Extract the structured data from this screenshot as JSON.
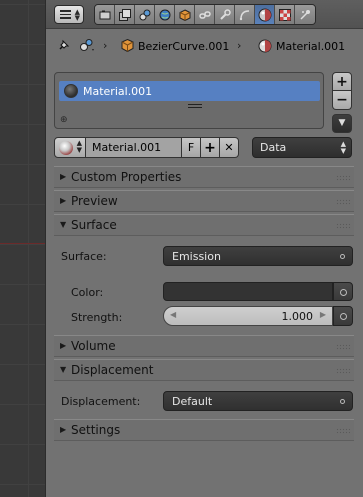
{
  "header": {
    "editor_type_icon": "properties-editor-icon",
    "context_tabs": [
      {
        "name": "render-icon",
        "active": false
      },
      {
        "name": "render-layers-icon",
        "active": false
      },
      {
        "name": "scene-icon",
        "active": false
      },
      {
        "name": "world-icon",
        "active": false
      },
      {
        "name": "object-icon",
        "active": false
      },
      {
        "name": "constraints-icon",
        "active": false
      },
      {
        "name": "modifiers-icon",
        "active": false
      },
      {
        "name": "curve-data-icon",
        "active": false
      },
      {
        "name": "material-icon",
        "active": true
      },
      {
        "name": "texture-icon",
        "active": false
      },
      {
        "name": "particles-icon",
        "active": false
      }
    ]
  },
  "path": {
    "object_name": "BezierCurve.001",
    "material_name": "Material.001",
    "separator": "›"
  },
  "slots": {
    "items": [
      {
        "label": "Material.001",
        "selected": true
      }
    ],
    "add_label": "+",
    "remove_label": "−",
    "menu_label": "▼"
  },
  "datablock": {
    "name": "Material.001",
    "fake_user_label": "F",
    "new_label": "+",
    "unlink_label": "✕",
    "link_value": "Data"
  },
  "panels": {
    "custom_properties": {
      "title": "Custom Properties",
      "expanded": false
    },
    "preview": {
      "title": "Preview",
      "expanded": false
    },
    "surface": {
      "title": "Surface",
      "expanded": true,
      "surface_label": "Surface:",
      "surface_value": "Emission",
      "color_label": "Color:",
      "color_value": "#333333",
      "strength_label": "Strength:",
      "strength_value": "1.000"
    },
    "volume": {
      "title": "Volume",
      "expanded": false
    },
    "displacement": {
      "title": "Displacement",
      "expanded": true,
      "displacement_label": "Displacement:",
      "displacement_value": "Default"
    },
    "settings": {
      "title": "Settings",
      "expanded": false
    }
  },
  "colors": {
    "panel_bg": "#727272",
    "selection": "#5680c2",
    "active_tab": "#5a81ba",
    "dark_widget": "#353535"
  }
}
